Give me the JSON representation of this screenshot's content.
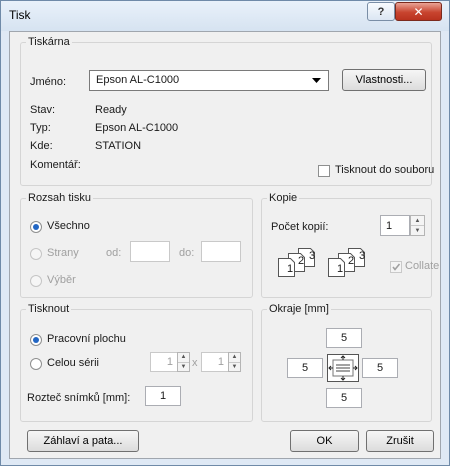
{
  "window": {
    "title": "Tisk",
    "help_glyph": "?",
    "close_glyph": "✕"
  },
  "printer": {
    "group_label": "Tiskárna",
    "name_label": "Jméno:",
    "name_value": "Epson AL-C1000",
    "properties_button": "Vlastnosti...",
    "status_label": "Stav:",
    "status_value": "Ready",
    "type_label": "Typ:",
    "type_value": "Epson AL-C1000",
    "where_label": "Kde:",
    "where_value": "STATION",
    "comment_label": "Komentář:",
    "print_to_file": "Tisknout do souboru"
  },
  "range": {
    "group_label": "Rozsah tisku",
    "all": "Všechno",
    "pages": "Strany",
    "from": "od:",
    "to": "do:",
    "selection": "Výběr"
  },
  "copies": {
    "group_label": "Kopie",
    "count_label": "Počet kopií:",
    "count_value": "1",
    "collate": "Collate",
    "page_numbers": [
      "1",
      "2",
      "3"
    ]
  },
  "print": {
    "group_label": "Tisknout",
    "workspace": "Pracovní plochu",
    "whole_series": "Celou sérii",
    "series_a": "1",
    "series_times": "x",
    "series_b": "1",
    "spacing_label": "Rozteč snímků [mm]:",
    "spacing_value": "1"
  },
  "margins": {
    "group_label": "Okraje [mm]",
    "top": "5",
    "left": "5",
    "right": "5",
    "bottom": "5"
  },
  "buttons": {
    "header_footer": "Záhlaví a pata...",
    "ok": "OK",
    "cancel": "Zrušit"
  }
}
